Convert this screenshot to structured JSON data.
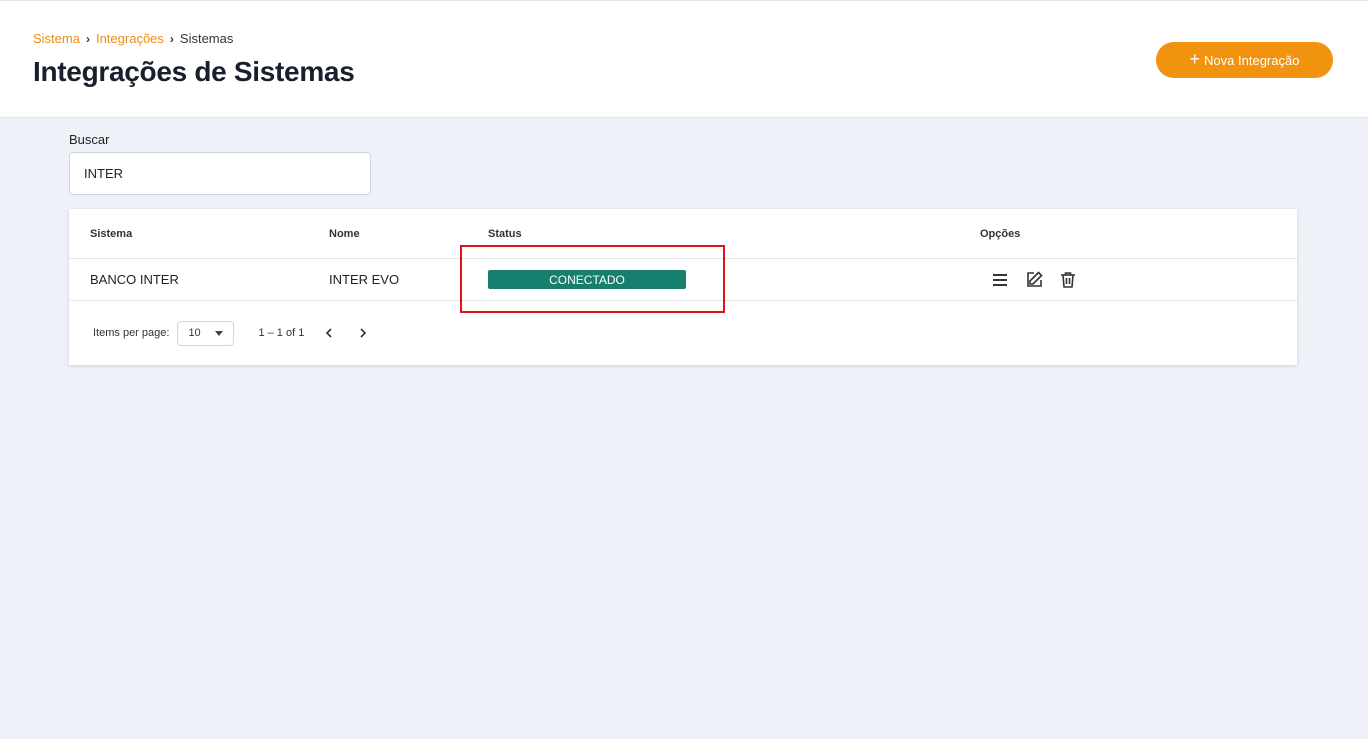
{
  "breadcrumb": {
    "items": [
      "Sistema",
      "Integrações"
    ],
    "current": "Sistemas",
    "separator": "›"
  },
  "page_title": "Integrações de Sistemas",
  "new_button": {
    "icon": "plus-icon",
    "label": "Nova Integração"
  },
  "search": {
    "label": "Buscar",
    "value": "INTER"
  },
  "table": {
    "headers": [
      "Sistema",
      "Nome",
      "Status",
      "Opções"
    ],
    "rows": [
      {
        "sistema": "BANCO INTER",
        "nome": "INTER EVO",
        "status": "CONECTADO"
      }
    ],
    "option_icons": [
      "menu-icon",
      "edit-icon",
      "trash-icon"
    ]
  },
  "paginator": {
    "items_per_page_label": "Items per page:",
    "items_per_page": "10",
    "range": "1 – 1 of 1"
  },
  "colors": {
    "accent": "#f2930f",
    "status_connected": "#177f6d",
    "highlight": "#e0131a"
  }
}
